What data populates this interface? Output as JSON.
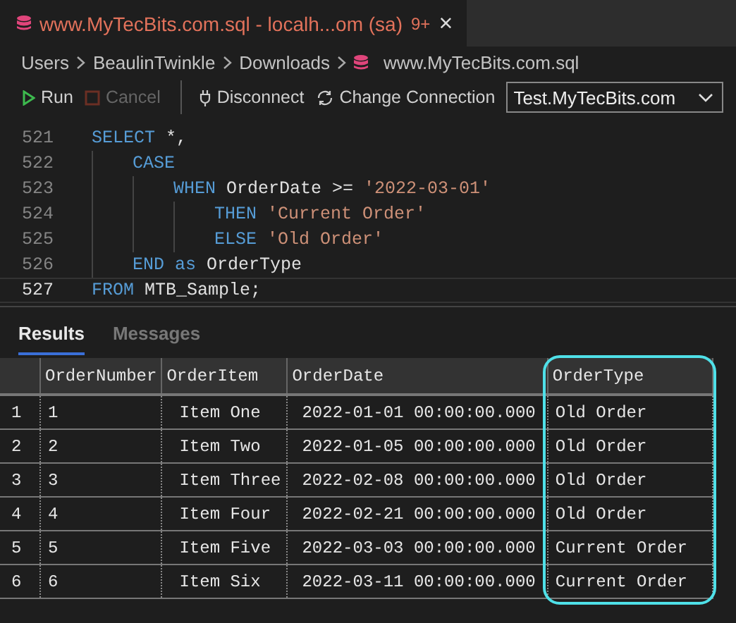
{
  "editor_tab": {
    "title": "www.MyTecBits.com.sql - localh...om (sa)",
    "badge": "9+",
    "close": "×",
    "selected": true
  },
  "breadcrumb": [
    "Users",
    "BeaulinTwinkle",
    "Downloads",
    "www.MyTecBits.com.sql"
  ],
  "toolbar": {
    "run": {
      "label": "Run",
      "disabled": false
    },
    "cancel": {
      "label": "Cancel",
      "disabled": true
    },
    "disconnect": "Disconnect",
    "change_connection": "Change Connection",
    "connection": {
      "value": "Test.MyTecBits.com"
    }
  },
  "code": [
    {
      "number": "521",
      "current": false,
      "tokens": [
        {
          "kind": "keyword",
          "text": "SELECT"
        },
        {
          "kind": "plain",
          "text": "*,"
        }
      ],
      "children": [
        {
          "number": "522",
          "current": false,
          "tokens": [
            {
              "kind": "keyword",
              "text": "CASE"
            }
          ],
          "children": [
            {
              "number": "523",
              "current": false,
              "tokens": [
                {
                  "kind": "keyword",
                  "text": "WHEN"
                },
                {
                  "kind": "plain",
                  "text": "OrderDate >="
                },
                {
                  "kind": "string",
                  "text": "'2022-03-01'"
                }
              ],
              "children": [
                {
                  "number": "524",
                  "current": false,
                  "tokens": [
                    {
                      "kind": "keyword",
                      "text": "THEN"
                    },
                    {
                      "kind": "string",
                      "text": "'Current Order'"
                    }
                  ]
                },
                {
                  "number": "525",
                  "current": false,
                  "tokens": [
                    {
                      "kind": "keyword",
                      "text": "ELSE"
                    },
                    {
                      "kind": "string",
                      "text": "'Old Order'"
                    }
                  ]
                }
              ]
            }
          ]
        },
        {
          "number": "526",
          "current": false,
          "tokens": [
            {
              "kind": "keyword",
              "text": "END"
            },
            {
              "kind": "keyword",
              "text": "as"
            },
            {
              "kind": "plain",
              "text": "OrderType"
            }
          ]
        }
      ]
    },
    {
      "number": "527",
      "current": true,
      "tokens": [
        {
          "kind": "keyword",
          "text": "FROM"
        },
        {
          "kind": "plain",
          "text": "MTB_Sample;"
        }
      ]
    }
  ],
  "result_tabs": [
    {
      "label": "Results",
      "selected": true
    },
    {
      "label": "Messages",
      "selected": false
    }
  ],
  "table": {
    "columns": [
      {
        "label": "OrderNumber",
        "highlighted": false
      },
      {
        "label": "OrderItem",
        "highlighted": false
      },
      {
        "label": "OrderDate",
        "highlighted": false
      },
      {
        "label": "OrderType",
        "highlighted": true
      }
    ],
    "rows": [
      {
        "number": "1",
        "cells": [
          "1",
          "Item One",
          "2022-01-01 00:00:00.000",
          "Old Order"
        ]
      },
      {
        "number": "2",
        "cells": [
          "2",
          "Item Two",
          "2022-01-05 00:00:00.000",
          "Old Order"
        ]
      },
      {
        "number": "3",
        "cells": [
          "3",
          "Item Three",
          "2022-02-08 00:00:00.000",
          "Old Order"
        ]
      },
      {
        "number": "4",
        "cells": [
          "4",
          "Item Four",
          "2022-02-21 00:00:00.000",
          "Old Order"
        ]
      },
      {
        "number": "5",
        "cells": [
          "5",
          "Item Five",
          "2022-03-03 00:00:00.000",
          "Current Order"
        ]
      },
      {
        "number": "6",
        "cells": [
          "6",
          "Item Six",
          "2022-03-11 00:00:00.000",
          "Current Order"
        ]
      }
    ]
  }
}
